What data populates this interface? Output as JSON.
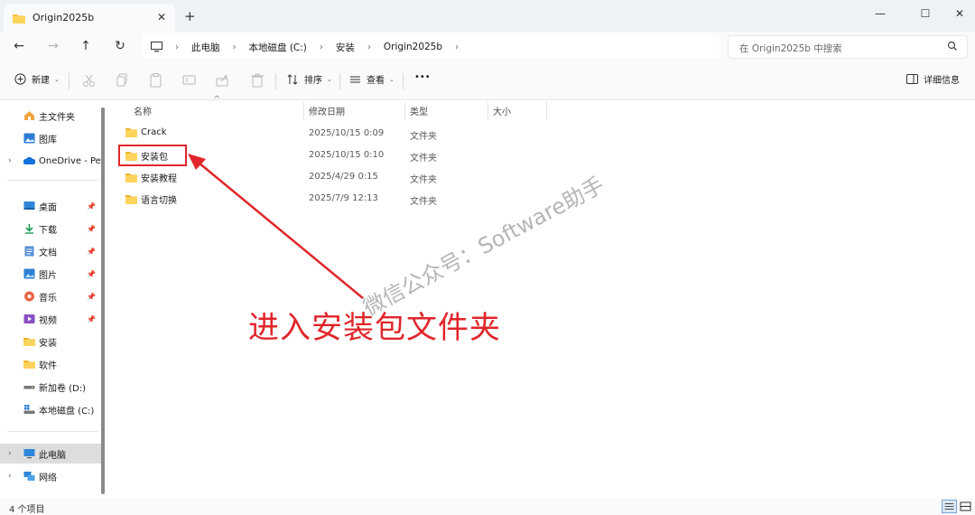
{
  "window": {
    "tab_title": "Origin2025b",
    "tab_close": "✕",
    "new_tab": "+",
    "minimize": "—",
    "maximize": "☐",
    "close": "✕"
  },
  "nav": {
    "back": "←",
    "forward": "→",
    "up": "↑",
    "refresh": "↻",
    "breadcrumb": [
      "此电脑",
      "本地磁盘 (C:)",
      "安装",
      "Origin2025b"
    ],
    "separator": "›",
    "search_placeholder": "在 Origin2025b 中搜索"
  },
  "commandbar": {
    "new_label": "新建",
    "sort_label": "排序",
    "view_label": "查看",
    "more": "•••",
    "details_label": "详细信息",
    "chevron": "⌄"
  },
  "sidebar": {
    "items": [
      {
        "label": "主文件夹",
        "icon": "home-icon"
      },
      {
        "label": "图库",
        "icon": "gallery-icon"
      },
      {
        "label": "OneDrive - Per",
        "icon": "onedrive-icon"
      },
      {
        "label": "桌面",
        "icon": "desktop-icon"
      },
      {
        "label": "下载",
        "icon": "download-icon"
      },
      {
        "label": "文档",
        "icon": "document-icon"
      },
      {
        "label": "图片",
        "icon": "pictures-icon"
      },
      {
        "label": "音乐",
        "icon": "music-icon"
      },
      {
        "label": "视频",
        "icon": "video-icon"
      },
      {
        "label": "安装",
        "icon": "folder-icon"
      },
      {
        "label": "软件",
        "icon": "folder-icon"
      },
      {
        "label": "新加卷 (D:)",
        "icon": "drive-icon"
      },
      {
        "label": "本地磁盘 (C:)",
        "icon": "drive-c-icon"
      },
      {
        "label": "此电脑",
        "icon": "this-pc-icon"
      },
      {
        "label": "网络",
        "icon": "network-icon"
      }
    ],
    "expander": "›",
    "pin": "📌"
  },
  "columns": {
    "name": "名称",
    "date": "修改日期",
    "type": "类型",
    "size": "大小",
    "sort_indicator": "^"
  },
  "files": [
    {
      "name": "Crack",
      "date": "2025/10/15 0:09",
      "type": "文件夹"
    },
    {
      "name": "安装包",
      "date": "2025/10/15 0:10",
      "type": "文件夹"
    },
    {
      "name": "安装教程",
      "date": "2025/4/29 0:15",
      "type": "文件夹"
    },
    {
      "name": "语言切换",
      "date": "2025/7/9 12:13",
      "type": "文件夹"
    }
  ],
  "annotation": {
    "text": "进入安装包文件夹",
    "watermark": "微信公众号：Software助手",
    "color": "#e0262a"
  },
  "status": {
    "count": "4 个项目"
  },
  "colors": {
    "folder": "#f5c244",
    "accent": "#0a64c8",
    "selection": "#dddddd"
  }
}
